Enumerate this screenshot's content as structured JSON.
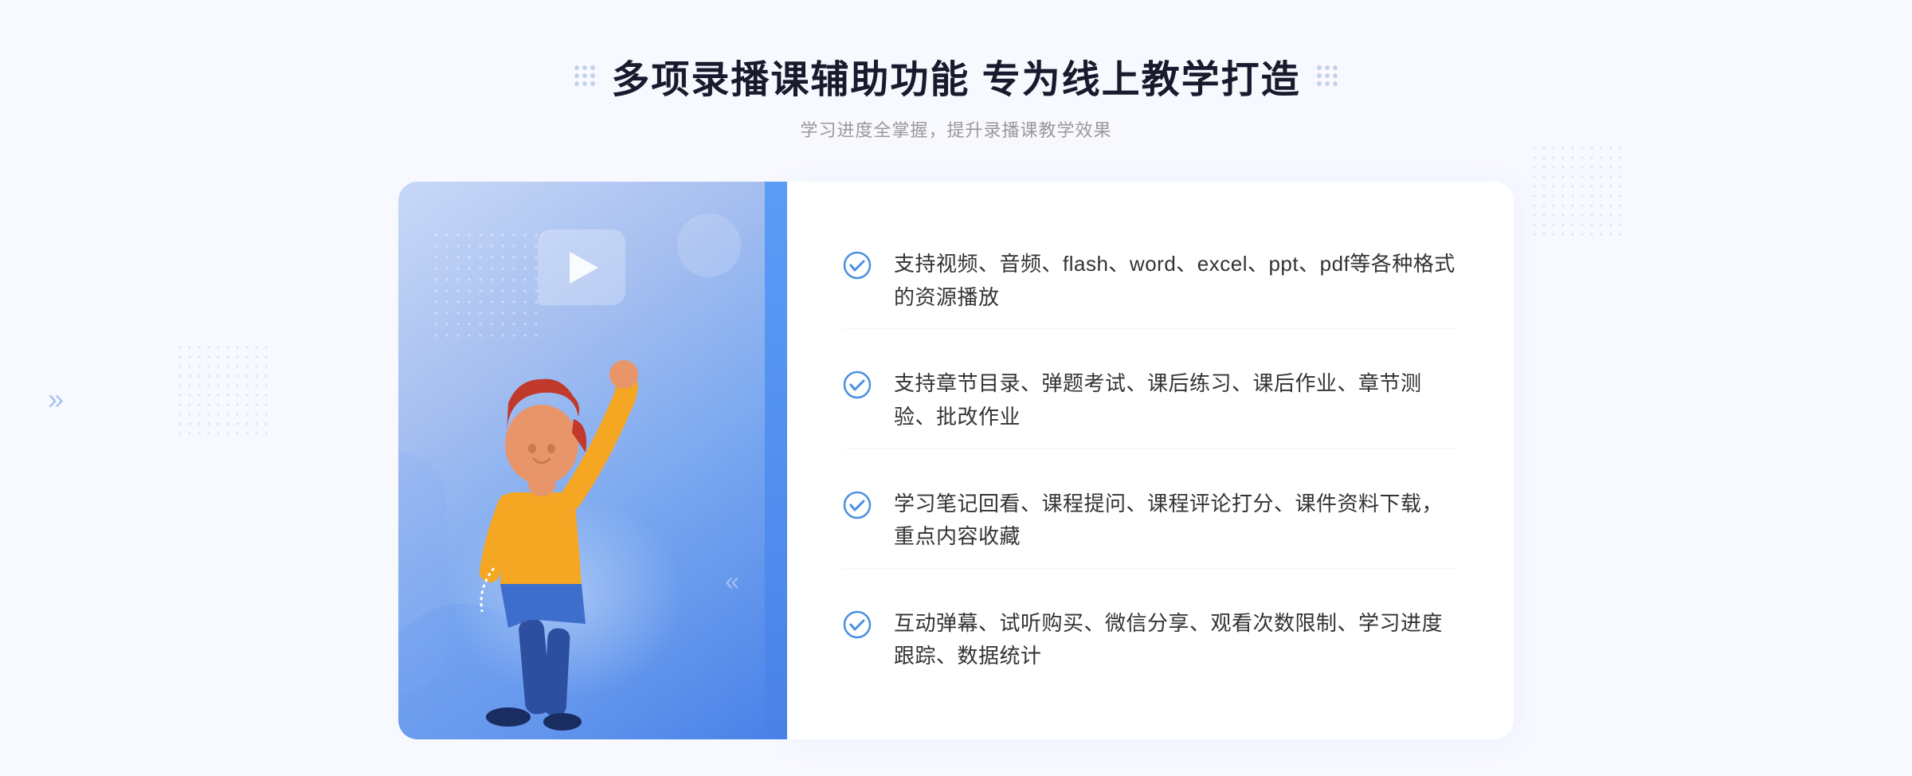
{
  "header": {
    "main_title": "多项录播课辅助功能 专为线上教学打造",
    "subtitle": "学习进度全掌握，提升录播课教学效果"
  },
  "features": [
    {
      "id": 1,
      "text": "支持视频、音频、flash、word、excel、ppt、pdf等各种格式的资源播放"
    },
    {
      "id": 2,
      "text": "支持章节目录、弹题考试、课后练习、课后作业、章节测验、批改作业"
    },
    {
      "id": 3,
      "text": "学习笔记回看、课程提问、课程评论打分、课件资料下载，重点内容收藏"
    },
    {
      "id": 4,
      "text": "互动弹幕、试听购买、微信分享、观看次数限制、学习进度跟踪、数据统计"
    }
  ],
  "colors": {
    "primary_blue": "#4a82e8",
    "light_blue": "#7aa8f0",
    "check_color": "#4a90e2",
    "title_color": "#1a1a2e",
    "text_color": "#333333",
    "subtitle_color": "#999999"
  },
  "icons": {
    "check": "✓",
    "play": "▶",
    "chevron_left": "»"
  }
}
